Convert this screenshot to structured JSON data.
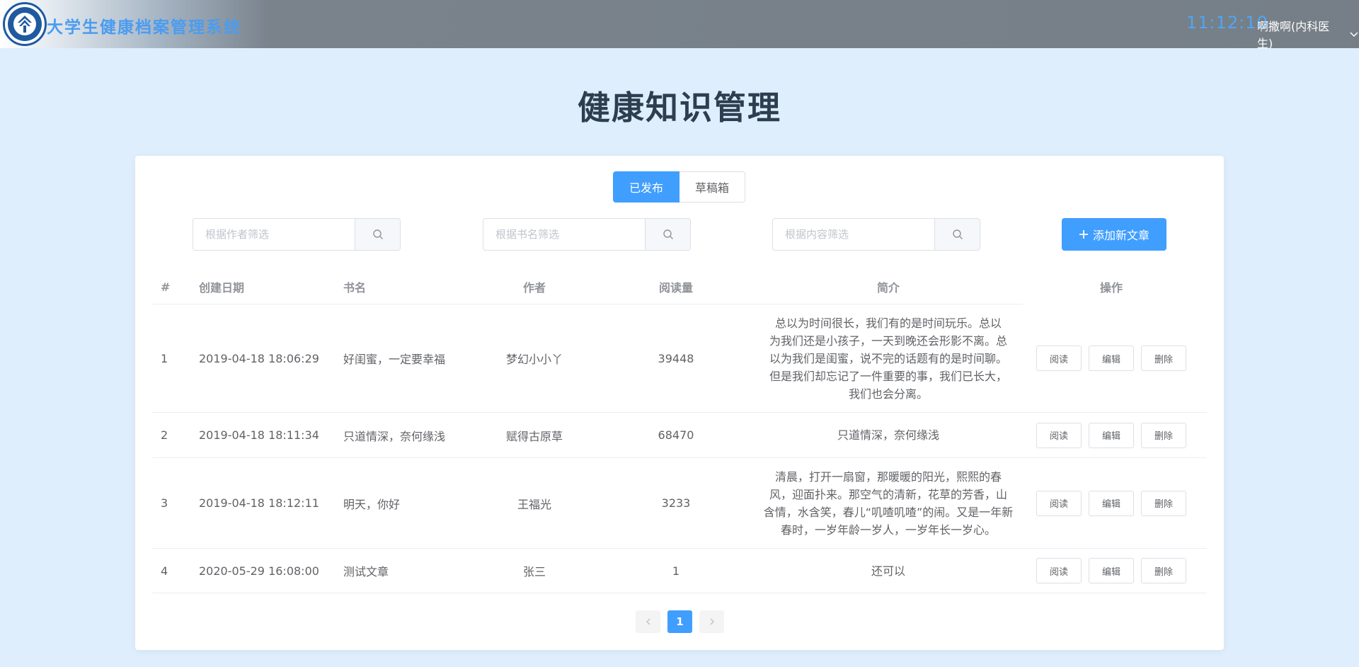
{
  "header": {
    "brand": "大学生健康档案管理系统",
    "clock": "11:12:10",
    "user": "啊撒啊(内科医生)"
  },
  "title": "健康知识管理",
  "tabs": {
    "published": "已发布",
    "drafts": "草稿箱"
  },
  "filters": {
    "author_placeholder": "根据作者筛选",
    "book_placeholder": "根据书名筛选",
    "content_placeholder": "根据内容筛选"
  },
  "add_button": "添加新文章",
  "columns": {
    "index": "#",
    "date": "创建日期",
    "book": "书名",
    "author": "作者",
    "reads": "阅读量",
    "intro": "简介",
    "ops": "操作"
  },
  "actions": {
    "read": "阅读",
    "edit": "编辑",
    "delete": "删除"
  },
  "rows": [
    {
      "index": "1",
      "date": "2019-04-18 18:06:29",
      "book": "好闺蜜，一定要幸福",
      "author": "梦幻小小丫",
      "reads": "39448",
      "intro_lines": [
        "总以为时间很长，我们有的是时间玩乐。总以",
        "为我们还是小孩子，一天到晚还会形影不离。总",
        "以为我们是闺蜜，说不完的话题有的是时间聊。",
        "但是我们却忘记了一件重要的事，我们已长大，",
        "我们也会分离。"
      ]
    },
    {
      "index": "2",
      "date": "2019-04-18 18:11:34",
      "book": "只道情深，奈何缘浅",
      "author": "赋得古原草",
      "reads": "68470",
      "intro_lines": [
        "只道情深，奈何缘浅"
      ]
    },
    {
      "index": "3",
      "date": "2019-04-18 18:12:11",
      "book": "明天，你好",
      "author": "王福光",
      "reads": "3233",
      "intro_lines": [
        "清晨，打开一扇窗，那暖暖的阳光，熙熙的春",
        "风，迎面扑来。那空气的清新，花草的芳香，山",
        "含情，水含笑，春儿“叽喳叽喳”的闹。又是一年新",
        "春时，一岁年龄一岁人，一岁年长一岁心。"
      ]
    },
    {
      "index": "4",
      "date": "2020-05-29 16:08:00",
      "book": "测试文章",
      "author": "张三",
      "reads": "1",
      "intro_lines": [
        "还可以"
      ]
    }
  ],
  "pagination": {
    "current": "1"
  },
  "colors": {
    "primary": "#409eff",
    "background": "#deeefd",
    "header": "#767f88"
  }
}
